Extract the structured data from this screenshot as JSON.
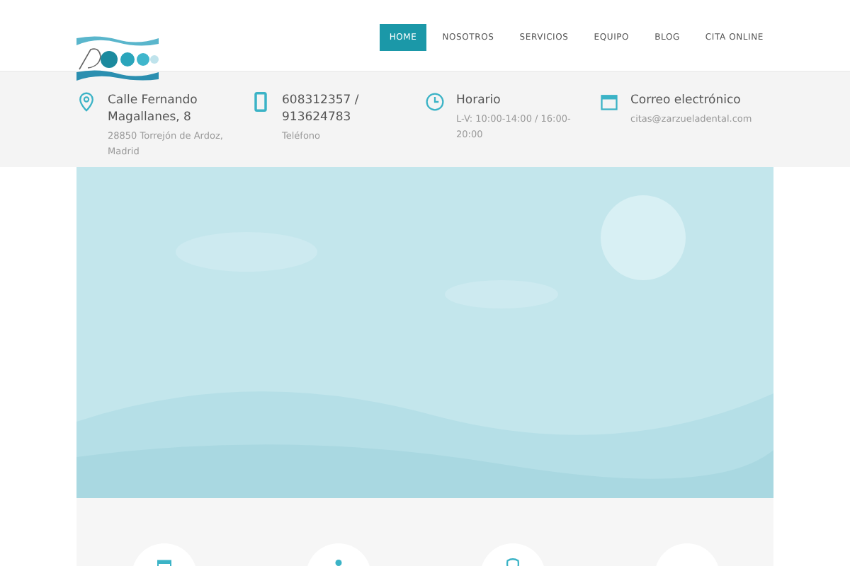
{
  "nav": [
    {
      "label": "HOME",
      "selected": true
    },
    {
      "label": "NOSOTROS",
      "selected": false
    },
    {
      "label": "SERVICIOS",
      "selected": false
    },
    {
      "label": "EQUIPO",
      "selected": false
    },
    {
      "label": "BLOG",
      "selected": false
    },
    {
      "label": "CITA ONLINE",
      "selected": false
    }
  ],
  "info": [
    {
      "kind": "location",
      "title": "Calle Fernando Magallanes, 8",
      "detail": "28850 Torrejón de Ardoz, Madrid"
    },
    {
      "kind": "phone",
      "title": "608312357 / 913624783",
      "detail": "Teléfono"
    },
    {
      "kind": "clock",
      "title": "Horario",
      "detail": "L-V: 10:00-14:00 / 16:00-20:00"
    },
    {
      "kind": "calendar",
      "title": "Correo electrónico",
      "detail": "citas@zarzueladental.com"
    }
  ],
  "features": [
    {
      "kind": "calendar"
    },
    {
      "kind": "person"
    },
    {
      "kind": "tooth"
    },
    {
      "kind": "blank"
    }
  ]
}
